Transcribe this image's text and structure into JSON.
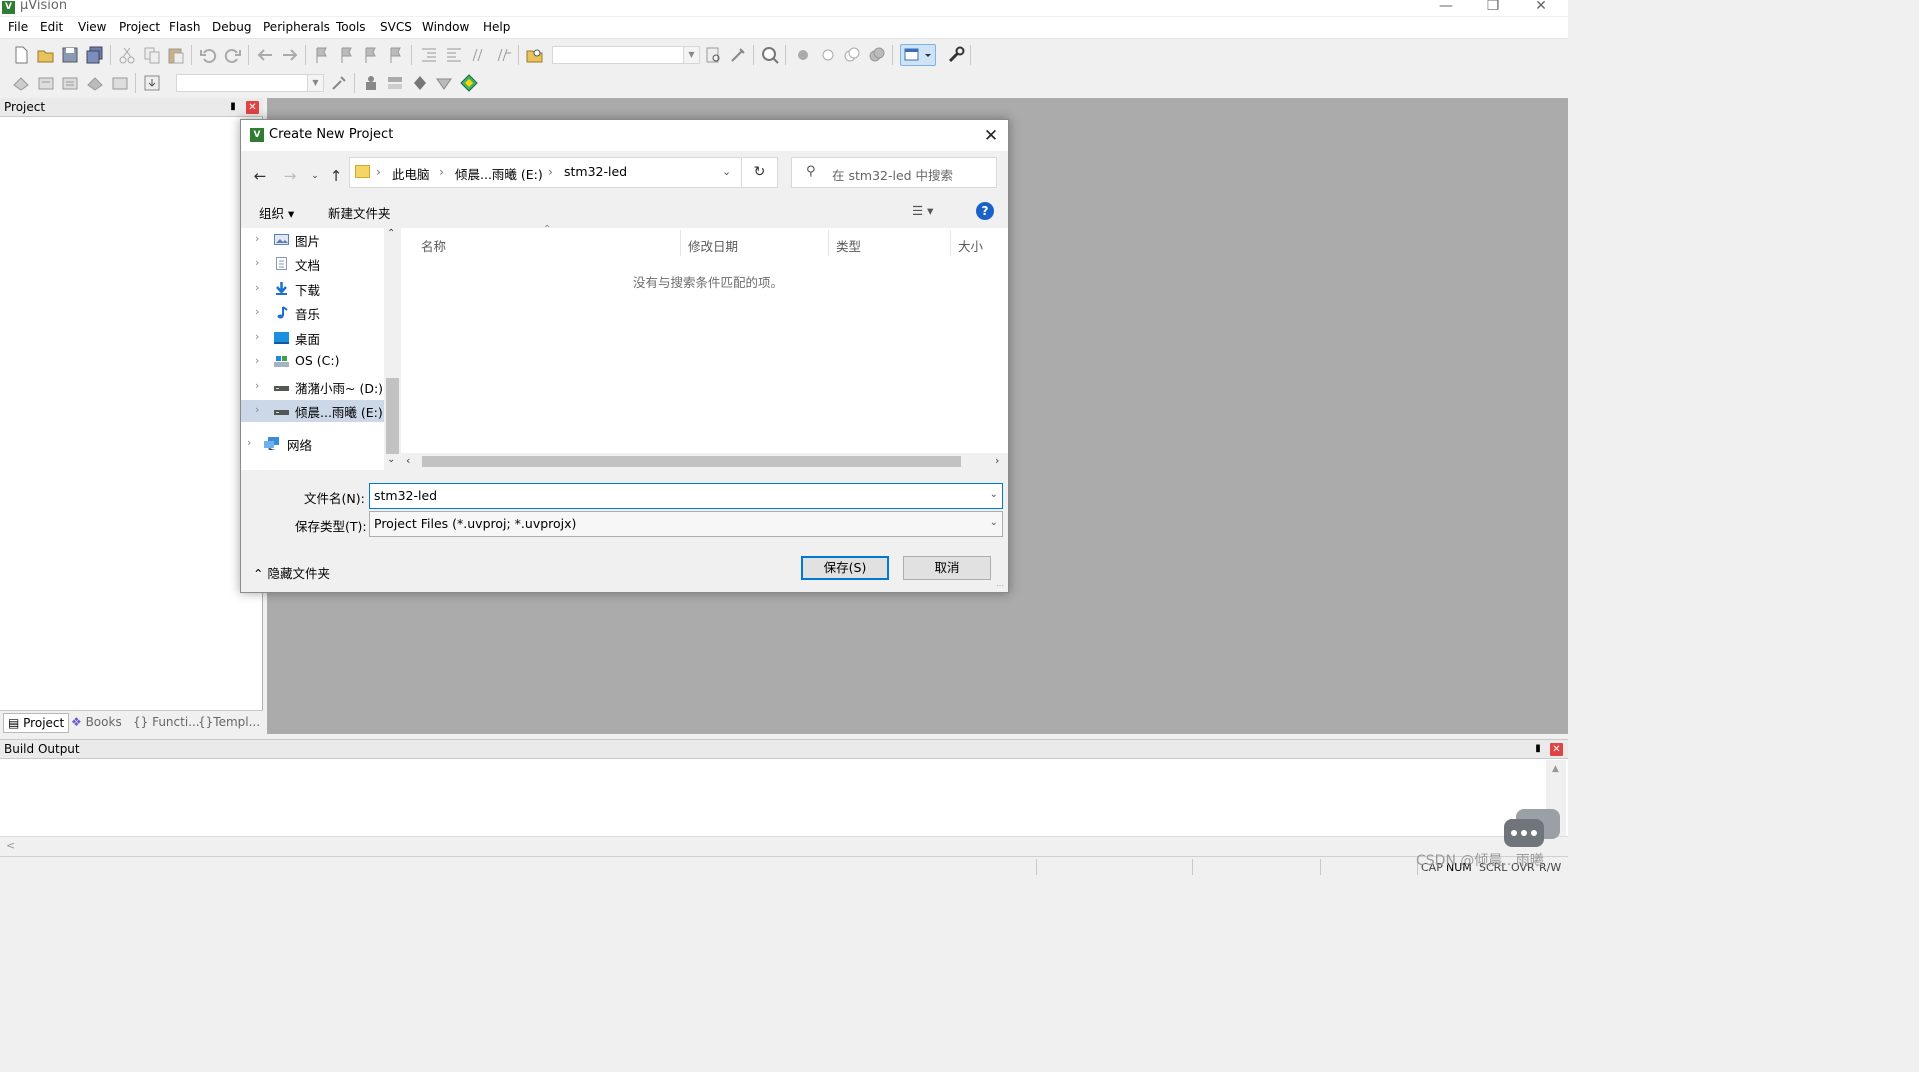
{
  "app": {
    "title": "µVision",
    "icon": "uvision-logo-icon",
    "window_controls": [
      "minimize",
      "restore",
      "close"
    ]
  },
  "menubar": {
    "items": [
      "File",
      "Edit",
      "View",
      "Project",
      "Flash",
      "Debug",
      "Peripherals",
      "Tools",
      "SVCS",
      "Window",
      "Help"
    ]
  },
  "project_panel": {
    "title": "Project",
    "tabs": [
      {
        "label": "Project",
        "icon": "project-icon",
        "active": true
      },
      {
        "label": "Books",
        "icon": "books-icon",
        "active": false
      },
      {
        "label": "{} Functi...",
        "icon": "functions-icon",
        "active": false
      },
      {
        "label": "Templ...",
        "icon": "templates-icon",
        "active": false
      }
    ]
  },
  "build_output": {
    "title": "Build Output"
  },
  "statusbar": {
    "indicators": [
      "CAP",
      "NUM",
      "SCRL",
      "OVR",
      "R/W"
    ]
  },
  "watermark": "CSDN @倾晨...雨曦",
  "dialog": {
    "title": "Create New Project",
    "address": {
      "crumbs": [
        "此电脑",
        "倾晨...雨曦 (E:)",
        "stm32-led"
      ]
    },
    "search_placeholder": "在 stm32-led 中搜索",
    "commands": {
      "organize": "组织 ▾",
      "new_folder": "新建文件夹"
    },
    "nav_items": [
      {
        "label": "图片",
        "icon": "pictures-icon",
        "color": "#5b7fb5"
      },
      {
        "label": "文档",
        "icon": "documents-icon",
        "color": "#8a9ab0"
      },
      {
        "label": "下载",
        "icon": "downloads-icon",
        "color": "#1e6fd0"
      },
      {
        "label": "音乐",
        "icon": "music-icon",
        "color": "#1e6fd0"
      },
      {
        "label": "桌面",
        "icon": "desktop-icon",
        "color": "#1b8fe0"
      },
      {
        "label": "OS (C:)",
        "icon": "drive-c-icon",
        "color": "#7a8ea8"
      },
      {
        "label": "潴潴小雨~ (D:)",
        "icon": "drive-icon",
        "color": "#555555"
      },
      {
        "label": "倾晨...雨曦 (E:)",
        "icon": "drive-icon",
        "color": "#555555",
        "selected": true
      },
      {
        "label": "网络",
        "icon": "network-icon",
        "color": "#3a8bd8"
      }
    ],
    "columns": [
      "名称",
      "修改日期",
      "类型",
      "大小"
    ],
    "empty_message": "没有与搜索条件匹配的项。",
    "filename_label": "文件名(N):",
    "filename_value": "stm32-led",
    "filetype_label": "保存类型(T):",
    "filetype_value": "Project Files (*.uvproj; *.uvprojx)",
    "hide_folders": "隐藏文件夹",
    "save_button": "保存(S)",
    "cancel_button": "取消"
  },
  "colors": {
    "accent": "#0078d7",
    "workspace": "#ababab",
    "close_red": "#e04343"
  }
}
